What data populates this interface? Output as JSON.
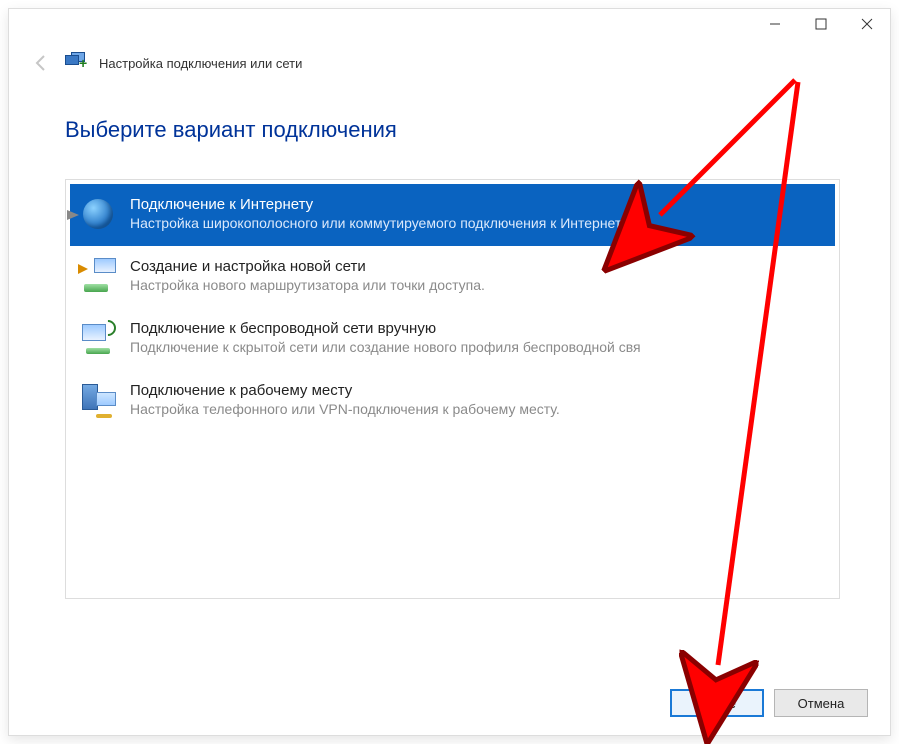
{
  "header": {
    "title": "Настройка подключения или сети"
  },
  "page": {
    "title": "Выберите вариант подключения"
  },
  "options": [
    {
      "title": "Подключение к Интернету",
      "desc": "Настройка широкополосного или коммутируемого подключения к Интернету."
    },
    {
      "title": "Создание и настройка новой сети",
      "desc": "Настройка нового маршрутизатора или точки доступа."
    },
    {
      "title": "Подключение к беспроводной сети вручную",
      "desc": "Подключение к скрытой сети или создание нового профиля беспроводной свя"
    },
    {
      "title": "Подключение к рабочему месту",
      "desc": "Настройка телефонного или VPN-подключения к рабочему месту."
    }
  ],
  "buttons": {
    "next": "Далее",
    "cancel": "Отмена"
  }
}
